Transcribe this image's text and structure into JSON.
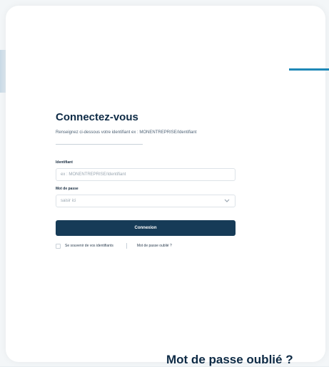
{
  "page": {
    "title": "Connectez-vous",
    "subtitle": "Renseignez ci-dessous votre identifiant ex : MONENTREPRISE/Identifiant"
  },
  "form": {
    "username": {
      "label": "Identifiant",
      "placeholder": "ex : MONENTREPRISE/Identifiant"
    },
    "password": {
      "label": "Mot de passe",
      "placeholder": "saisir ici",
      "visibility_icon": "chevron-down-icon"
    },
    "submit_label": "Connexion",
    "remember_label": "Se souvenir de vos identifiants",
    "forgot_label": "Mot de passe oublié ?"
  },
  "bottom_heading": "Mot de passe oublié ?",
  "colors": {
    "primary": "#163B57",
    "accent": "#1E88B7",
    "text": "#0D2A45",
    "muted": "#4E6275"
  }
}
